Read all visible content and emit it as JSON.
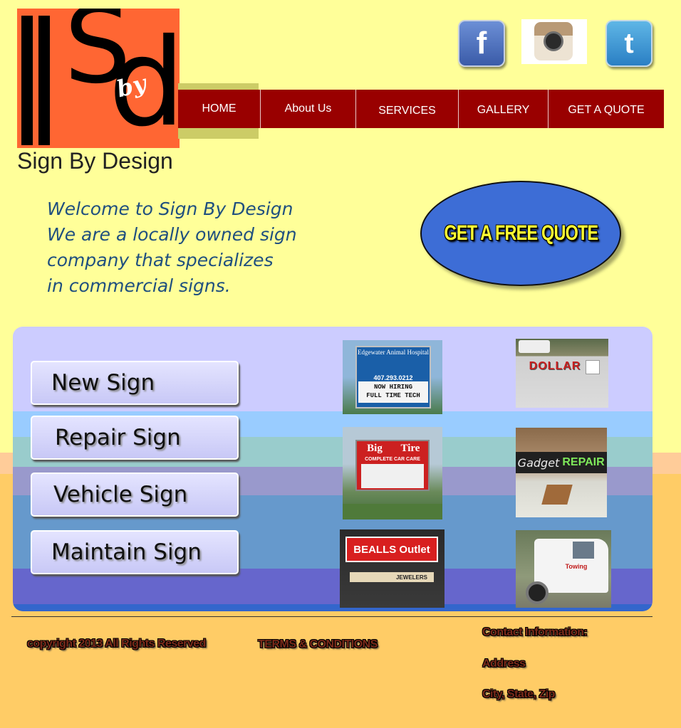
{
  "brand": {
    "name": "Sign By Design",
    "logo_text": "by",
    "colors": {
      "logo_bg": "#ff6633",
      "nav_bg": "#990000",
      "page_bg": "#ffff99",
      "welcome_text": "#1f4f7f",
      "quote_button": "#3d6dd6",
      "quote_text": "#ffff33"
    }
  },
  "social": [
    {
      "name": "facebook",
      "glyph": "f",
      "icon": "facebook-icon"
    },
    {
      "name": "instagram",
      "icon": "instagram-icon"
    },
    {
      "name": "twitter",
      "glyph": "t",
      "icon": "twitter-icon"
    }
  ],
  "nav": {
    "items": [
      {
        "label": "HOME"
      },
      {
        "label": "About Us"
      },
      {
        "label": "SERVICES"
      },
      {
        "label": "GALLERY"
      },
      {
        "label": "GET A QUOTE"
      }
    ]
  },
  "welcome": {
    "lines": [
      "Welcome to Sign By Design",
      "We are a locally owned sign",
      "company that specializes",
      "in commercial signs."
    ]
  },
  "quote_button": {
    "label": "GET A FREE QUOTE"
  },
  "services": [
    {
      "label": "New Sign"
    },
    {
      "label": "Repair Sign"
    },
    {
      "label": "Vehicle Sign"
    },
    {
      "label": "Maintain Sign"
    }
  ],
  "gallery": {
    "photos": [
      {
        "lines": [
          "Edgewater Animal Hospital",
          "407.293.0212",
          "NOW HIRING",
          "FULL TIME TECH"
        ]
      },
      {
        "lines": [
          "DOLLAR"
        ]
      },
      {
        "lines": [
          "Big",
          "Tire",
          "COMPLETE CAR CARE"
        ]
      },
      {
        "lines": [
          "Gadget",
          "REPAIR"
        ]
      },
      {
        "lines": [
          "BEALLS Outlet",
          "JEWELERS"
        ]
      },
      {
        "lines": [
          "Towing"
        ]
      }
    ]
  },
  "footer": {
    "copyright": "copyright 2013 All Rights Reserved",
    "terms": "TERMS & CONDITIONS",
    "contact_title": "Contact Information:",
    "address": "Address",
    "city_state_zip": "City, State, Zip"
  }
}
